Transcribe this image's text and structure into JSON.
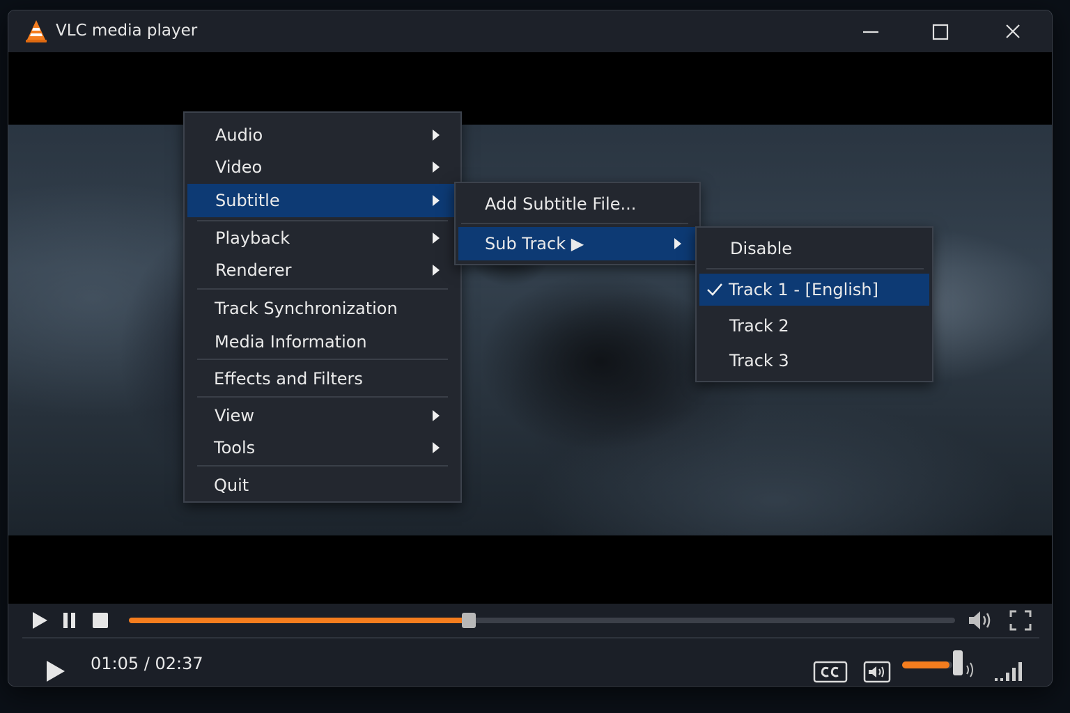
{
  "window": {
    "title": "VLC media player",
    "icon": "vlc-cone-icon",
    "buttons": [
      "minimize-icon",
      "maximize-icon",
      "close-icon"
    ]
  },
  "main_menu": {
    "items": [
      {
        "label": "Audio",
        "submenu": true
      },
      {
        "label": "Video",
        "submenu": true
      },
      {
        "label": "Subtitle",
        "submenu": true,
        "active": true
      },
      {
        "label": "Playback",
        "submenu": true
      },
      {
        "label": "Renderer",
        "submenu": true
      },
      {
        "label": "Track Synchronization",
        "submenu": false
      },
      {
        "label": "Media Information",
        "submenu": false
      },
      {
        "label": "Effects and Filters",
        "submenu": false
      },
      {
        "label": "View",
        "submenu": true
      },
      {
        "label": "Tools",
        "submenu": true
      },
      {
        "label": "Quit",
        "submenu": false
      }
    ]
  },
  "subtitle_menu": {
    "items": [
      {
        "label": "Add Subtitle File...",
        "submenu": false
      },
      {
        "label": "Sub Track ▶",
        "submenu": true,
        "active": true
      }
    ]
  },
  "subtrack_menu": {
    "items": [
      {
        "label": "Disable",
        "checked": false
      },
      {
        "label": "Track 1 - [English]",
        "checked": true,
        "active": true
      },
      {
        "label": "Track 2",
        "checked": false
      },
      {
        "label": "Track 3",
        "checked": false
      }
    ]
  },
  "controls": {
    "time": "01:05 / 02:37",
    "progress_fraction": 0.41,
    "volume_fraction": 0.8,
    "icons": [
      "play-icon",
      "pause-icon",
      "stop-icon",
      "volume-icon",
      "fullscreen-icon",
      "cc-icon",
      "audio-track-icon",
      "signal-bars-icon"
    ]
  },
  "colors": {
    "accent": "#f57d1e",
    "menu_highlight": "#0d3a74",
    "menu_bg": "#23272f",
    "window_bg": "#1b1f27"
  }
}
